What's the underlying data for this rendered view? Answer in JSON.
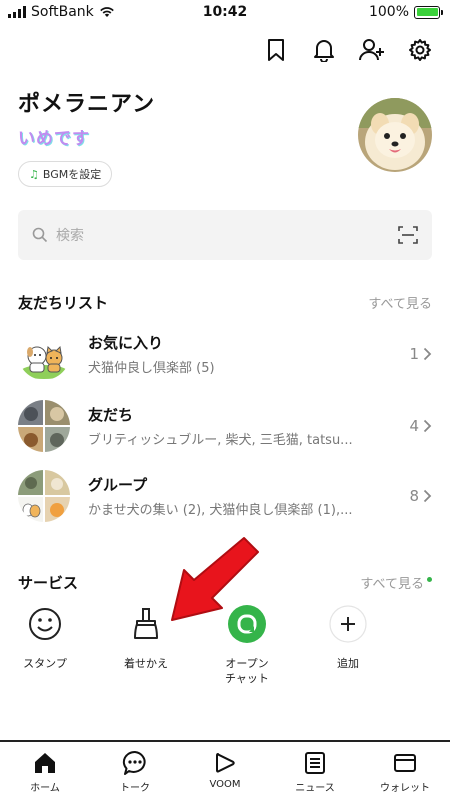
{
  "status_bar": {
    "carrier": "SoftBank",
    "time": "10:42",
    "battery": "100%",
    "battery_level": 1.0
  },
  "profile": {
    "name": "ポメラニアン",
    "status_message": "いめです",
    "bgm_label": "BGMを設定"
  },
  "search": {
    "placeholder": "検索"
  },
  "friends_section": {
    "title": "友だちリスト",
    "see_all": "すべて見る",
    "groups": [
      {
        "title": "お気に入り",
        "subtitle": "犬猫仲良し倶楽部 (5)",
        "count": "1"
      },
      {
        "title": "友だち",
        "subtitle": "ブリティッシュブルー, 柴犬, 三毛猫, tatsu...",
        "count": "4"
      },
      {
        "title": "グループ",
        "subtitle": "かませ犬の集い (2), 犬猫仲良し倶楽部 (1),...",
        "count": "8"
      }
    ]
  },
  "services_section": {
    "title": "サービス",
    "see_all": "すべて見る",
    "items": [
      {
        "label": "スタンプ",
        "icon": "smiley-icon"
      },
      {
        "label": "着せかえ",
        "icon": "brush-icon"
      },
      {
        "label_line1": "オープン",
        "label_line2": "チャット",
        "icon": "open-chat-icon"
      },
      {
        "label": "追加",
        "icon": "plus-icon"
      }
    ]
  },
  "bottom_nav": {
    "items": [
      {
        "label": "ホーム",
        "icon": "home-icon"
      },
      {
        "label": "トーク",
        "icon": "chat-icon"
      },
      {
        "label": "VOOM",
        "icon": "voom-icon"
      },
      {
        "label": "ニュース",
        "icon": "news-icon"
      },
      {
        "label": "ウォレット",
        "icon": "wallet-icon"
      }
    ]
  },
  "colors": {
    "accent_green": "#35b44a",
    "arrow_red": "#e8141c",
    "battery_green": "#3ad13a"
  }
}
